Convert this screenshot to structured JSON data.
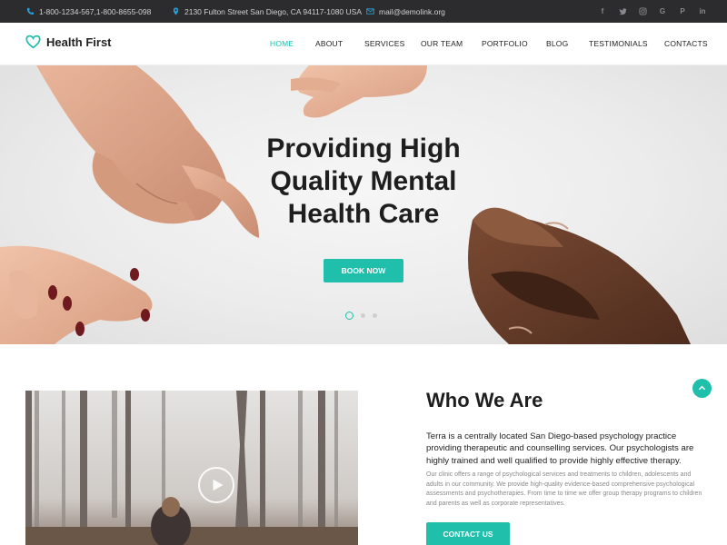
{
  "topbar": {
    "phone": "1-800-1234-567,1-800-8655-098",
    "address": "2130 Fulton Street San Diego, CA 94117-1080 USA",
    "email": "mail@demolink.org",
    "phone_icon": "phone-icon",
    "address_icon": "map-pin-icon",
    "email_icon": "envelope-icon",
    "socials": [
      {
        "icon": "facebook-icon",
        "glyph": "f"
      },
      {
        "icon": "twitter-icon",
        "glyph": ""
      },
      {
        "icon": "instagram-icon",
        "glyph": ""
      },
      {
        "icon": "google-icon",
        "glyph": "G"
      },
      {
        "icon": "pinterest-icon",
        "glyph": "P"
      },
      {
        "icon": "linkedin-icon",
        "glyph": "in"
      }
    ]
  },
  "nav": {
    "brand": "Health First",
    "logo_icon": "heart-icon",
    "items": [
      {
        "label": "HOME",
        "active": true
      },
      {
        "label": "ABOUT",
        "active": false
      },
      {
        "label": "SERVICES",
        "active": false
      },
      {
        "label": "OUR TEAM",
        "active": false
      },
      {
        "label": "PORTFOLIO",
        "active": false
      },
      {
        "label": "BLOG",
        "active": false
      },
      {
        "label": "TESTIMONIALS",
        "active": false
      },
      {
        "label": "CONTACTS",
        "active": false
      }
    ]
  },
  "hero": {
    "title_lines": [
      "Providing High",
      "Quality Mental",
      "Health Care"
    ],
    "cta": "BOOK NOW",
    "slides": 3,
    "active_slide": 1
  },
  "about": {
    "title": "Who We Are",
    "lead": "Terra is a centrally located San Diego-based psychology practice providing therapeutic and counselling services. Our psychologists are highly trained and well qualified to provide highly effective therapy.",
    "body": "Our clinic offers a range of psychological services and treatments to children, adolescents and adults in our community. We provide high-quality evidence-based comprehensive psychological assessments and psychotherapies. From time to time we offer group therapy programs to children and parents as well as corporate representatives.",
    "cta": "CONTACT US",
    "video_icon": "play-icon"
  },
  "scroll_up_icon": "arrow-up-icon",
  "colors": {
    "accent": "#1fbfac",
    "topbar_bg": "#2c2c2e",
    "topbar_icon": "#2a9fd6"
  }
}
